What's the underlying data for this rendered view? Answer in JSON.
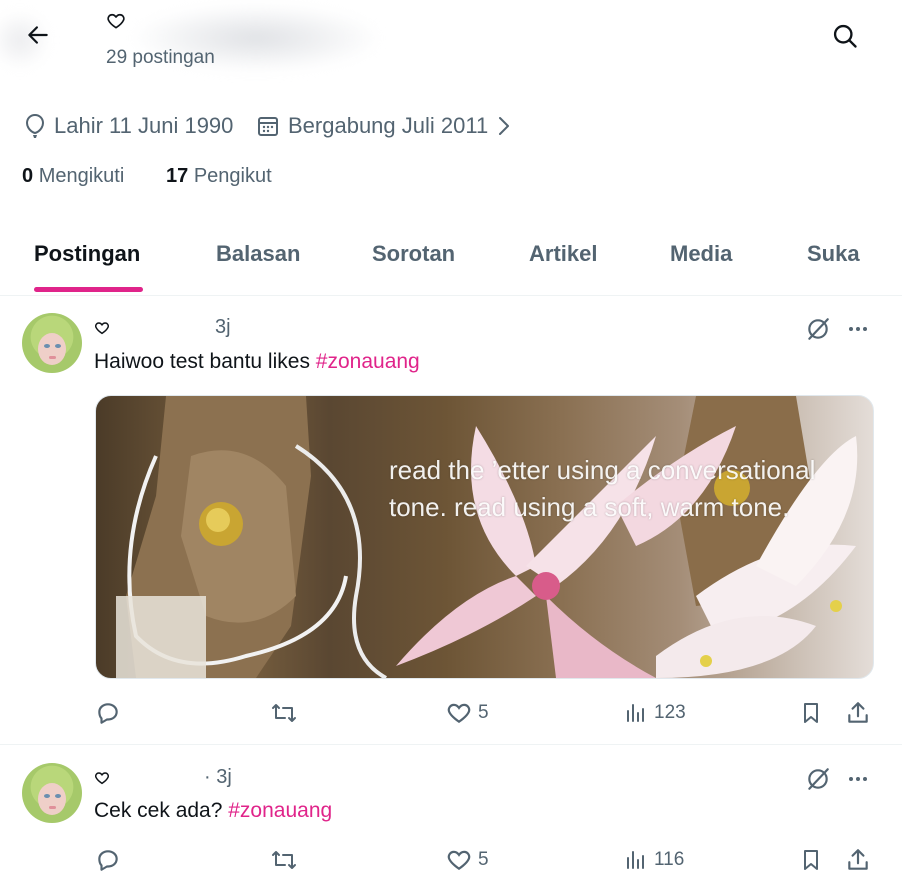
{
  "header": {
    "post_count": "29 postingan"
  },
  "profile": {
    "birth": "Lahir 11 Juni 1990",
    "joined": "Bergabung Juli 2011",
    "following_count": "0",
    "following_label": "Mengikuti",
    "followers_count": "17",
    "followers_label": "Pengikut"
  },
  "tabs": [
    {
      "label": "Postingan"
    },
    {
      "label": "Balasan"
    },
    {
      "label": "Sorotan"
    },
    {
      "label": "Artikel"
    },
    {
      "label": "Media"
    },
    {
      "label": "Suka"
    }
  ],
  "posts": [
    {
      "time": "3j",
      "text": "Haiwoo test bantu likes ",
      "hashtag": "#zonauang",
      "media_text": "read the ’etter using a conversational tone. read using a soft, warm tone.",
      "likes": "5",
      "views": "123"
    },
    {
      "time": "· 3j",
      "text": "Cek cek ada? ",
      "hashtag": "#zonauang",
      "likes": "5",
      "views": "116"
    }
  ],
  "colors": {
    "accent": "#e0248a",
    "secondary_text": "#536471",
    "primary_text": "#0f1419"
  }
}
